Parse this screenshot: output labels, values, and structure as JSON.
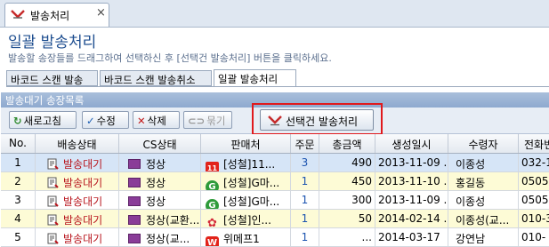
{
  "window": {
    "tab_title": "발송처리",
    "close_glyph": "×"
  },
  "page": {
    "heading": "일괄 발송처리",
    "description": "발송할 송장들를 드래그하여 선택하신 후 [선택건 발송처리] 버튼을 클릭하세요."
  },
  "tabs": [
    {
      "label": "바코드 스캔 발송"
    },
    {
      "label": "바코드 스캔 발송취소"
    },
    {
      "label": "일괄 발송처리"
    }
  ],
  "panel": {
    "title": "발송대기 송장목록"
  },
  "toolbar": {
    "refresh": "새로고침",
    "edit": "수정",
    "delete": "삭제",
    "group": "묶기",
    "process_selected": "선택건 발송처리"
  },
  "grid": {
    "columns": [
      "No.",
      "배송상태",
      "CS상태",
      "판매처",
      "주문",
      "총금액",
      "생성일시",
      "수령자",
      "전화번"
    ],
    "rows": [
      {
        "no": "1",
        "status": "발송대기",
        "cs": "정상",
        "seller": "[성철]11...",
        "seller_icon": "11st",
        "orders": "3",
        "amount": "490",
        "created": "2013-11-09 ...",
        "recipient": "이종성",
        "phone": "032-1"
      },
      {
        "no": "2",
        "status": "발송대기",
        "cs": "정상",
        "seller": "[성철]G마...",
        "seller_icon": "gmarket",
        "orders": "1",
        "amount": "450",
        "created": "2013-11-10 ...",
        "recipient": "홍길동",
        "phone": "0505-"
      },
      {
        "no": "3",
        "status": "발송대기",
        "cs": "정상",
        "seller": "[성철]G마...",
        "seller_icon": "gmarket",
        "orders": "1",
        "amount": "300",
        "created": "2013-11-09 ...",
        "recipient": "이종성",
        "phone": "0505-"
      },
      {
        "no": "4",
        "status": "발송대기",
        "cs": "정상(교환...",
        "seller": "[성철]인...",
        "seller_icon": "interpark",
        "orders": "1",
        "amount": "50",
        "created": "2014-02-14 ...",
        "recipient": "이종성(교...",
        "phone": "010-3"
      },
      {
        "no": "5",
        "status": "발송대기",
        "cs": "정상(교...",
        "seller": "위메프1",
        "seller_icon": "wemakeprice",
        "orders": "1",
        "amount": "...",
        "created": "2014-03-17",
        "recipient": "강연남",
        "phone": "010-"
      }
    ]
  },
  "colors": {
    "highlight_box": "#e0191d",
    "status_text": "#b8141c",
    "order_count": "#1c54b0",
    "selected_row": "#d6e5f7",
    "alt_row": "#fdfbd6"
  }
}
